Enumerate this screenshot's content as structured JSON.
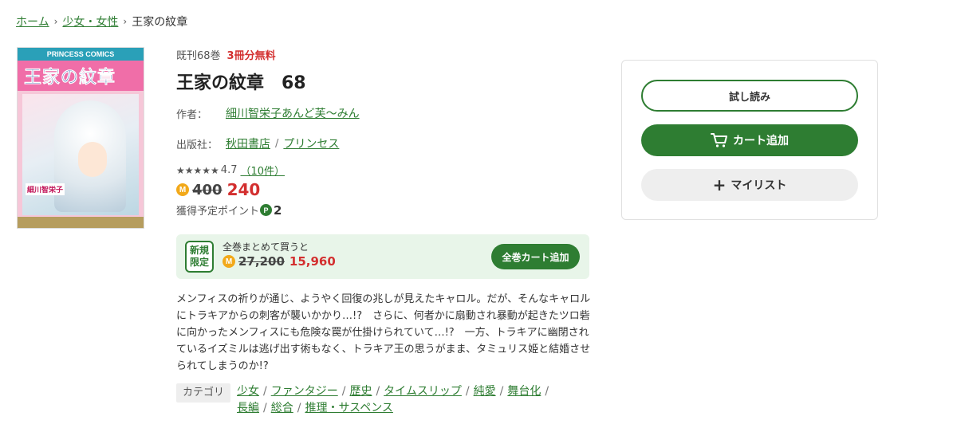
{
  "breadcrumb": {
    "items": [
      "ホーム",
      "少女・女性"
    ],
    "current": "王家の紋章"
  },
  "cover": {
    "series_label": "PRINCESS COMICS",
    "title": "王家の紋章",
    "author_label": "細川智栄子"
  },
  "book": {
    "volumes": "既刊68巻",
    "free_label": "3冊分無料",
    "title": "王家の紋章　68",
    "author_label": "作者：",
    "author": "細川智栄子あんど芙～みん",
    "publisher_label": "出版社：",
    "publisher": "秋田書店",
    "label": "プリンセス",
    "stars": "★★★★★",
    "rating": "4.7",
    "reviews": "（10件）",
    "price_old": "400",
    "price_new": "240",
    "points_label": "獲得予定ポイント",
    "points": "2"
  },
  "bulk": {
    "badge": "新規限定",
    "text": "全巻まとめて買うと",
    "price_old": "27,200",
    "price_new": "15,960",
    "button": "全巻カート追加"
  },
  "description": "メンフィスの祈りが通じ、ようやく回復の兆しが見えたキャロル。だが、そんなキャロルにトラキアからの刺客が襲いかかり…!?　さらに、何者かに扇動され暴動が起きたツロ砦に向かったメンフィスにも危険な罠が仕掛けられていて…!?　一方、トラキアに幽閉されているイズミルは逃げ出す術もなく、トラキア王の思うがまま、タミュリス姫と結婚させられてしまうのか!?",
  "categories": {
    "label": "カテゴリ",
    "items": [
      "少女",
      "ファンタジー",
      "歴史",
      "タイムスリップ",
      "純愛",
      "舞台化",
      "長編",
      "総合",
      "推理・サスペンス"
    ]
  },
  "panel": {
    "trial": "試し読み",
    "cart": "カート追加",
    "mylist": "マイリスト"
  },
  "colors": {
    "accent": "#2e7d32",
    "price": "#d32f2f",
    "coin": "#f2a91a"
  }
}
